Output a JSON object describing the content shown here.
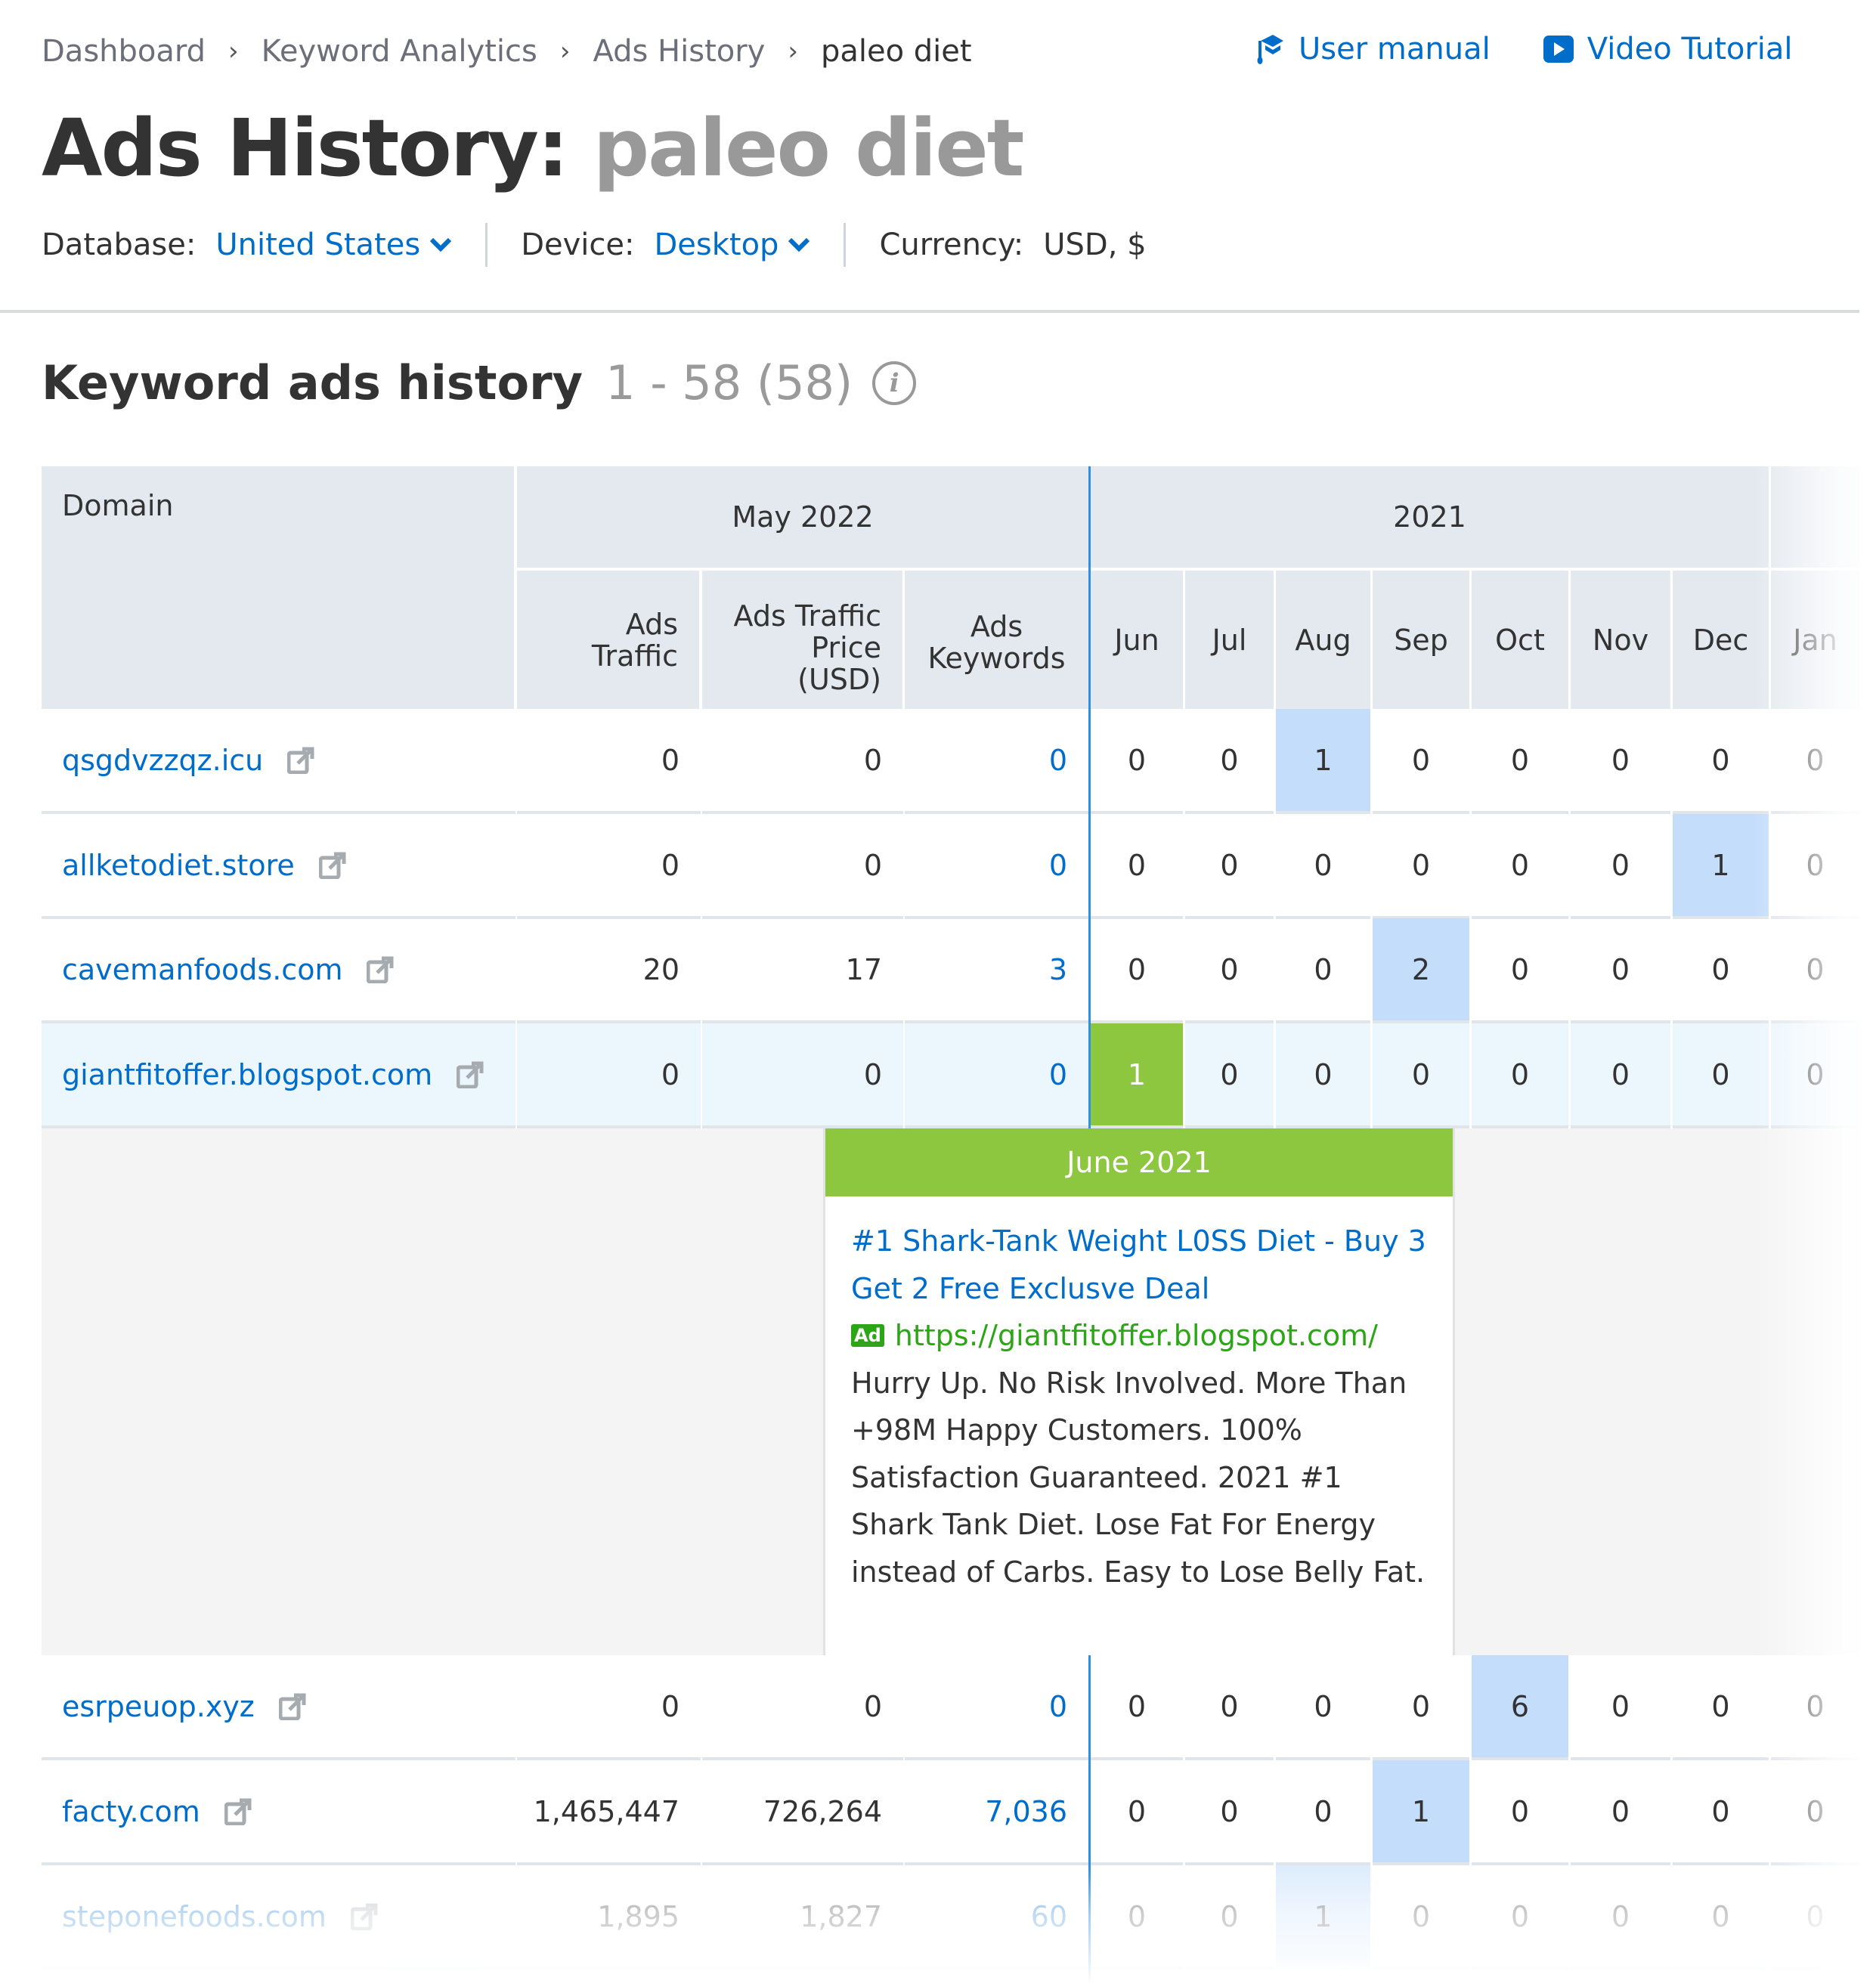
{
  "breadcrumb": [
    "Dashboard",
    "Keyword Analytics",
    "Ads History",
    "paleo diet"
  ],
  "top_links": {
    "user_manual": "User manual",
    "video_tutorial": "Video Tutorial"
  },
  "title": {
    "prefix": "Ads History:",
    "keyword": "paleo diet"
  },
  "filters": {
    "database_label": "Database:",
    "database_value": "United States",
    "device_label": "Device:",
    "device_value": "Desktop",
    "currency_label": "Currency:",
    "currency_value": "USD, $"
  },
  "section": {
    "title": "Keyword ads history",
    "count": "1 - 58 (58)"
  },
  "table": {
    "domain_header": "Domain",
    "group_may": "May 2022",
    "group_year": "2021",
    "col_ads_traffic": "Ads Traffic",
    "col_ads_traffic_price": "Ads Traffic Price (USD)",
    "col_ads_keywords": "Ads Keywords",
    "months": [
      "Jun",
      "Jul",
      "Aug",
      "Sep",
      "Oct",
      "Nov",
      "Dec",
      "Jan"
    ],
    "rows_top": [
      {
        "domain": "qsgdvzzqz.icu",
        "traffic": "0",
        "price": "0",
        "keywords": "0",
        "months": [
          "0",
          "0",
          "1",
          "0",
          "0",
          "0",
          "0",
          "0"
        ]
      },
      {
        "domain": "allketodiet.store",
        "traffic": "0",
        "price": "0",
        "keywords": "0",
        "months": [
          "0",
          "0",
          "0",
          "0",
          "0",
          "0",
          "1",
          "0"
        ]
      },
      {
        "domain": "cavemanfoods.com",
        "traffic": "20",
        "price": "17",
        "keywords": "3",
        "months": [
          "0",
          "0",
          "0",
          "2",
          "0",
          "0",
          "0",
          "0"
        ]
      },
      {
        "domain": "giantfitoffer.blogspot.com",
        "traffic": "0",
        "price": "0",
        "keywords": "0",
        "months": [
          "1",
          "0",
          "0",
          "0",
          "0",
          "0",
          "0",
          "0"
        ]
      }
    ],
    "rows_bottom": [
      {
        "domain": "esrpeuop.xyz",
        "traffic": "0",
        "price": "0",
        "keywords": "0",
        "months": [
          "0",
          "0",
          "0",
          "0",
          "6",
          "0",
          "0",
          "0"
        ]
      },
      {
        "domain": "facty.com",
        "traffic": "1,465,447",
        "price": "726,264",
        "keywords": "7,036",
        "months": [
          "0",
          "0",
          "0",
          "1",
          "0",
          "0",
          "0",
          "0"
        ]
      },
      {
        "domain": "steponefoods.com",
        "traffic": "1,895",
        "price": "1,827",
        "keywords": "60",
        "months": [
          "0",
          "0",
          "1",
          "0",
          "0",
          "0",
          "0",
          "0"
        ]
      }
    ]
  },
  "popup": {
    "header": "June 2021",
    "ad_title": "#1 Shark-Tank Weight L0SS Diet - Buy 3 Get 2 Free Exclusve Deal",
    "ad_badge": "Ad",
    "ad_url": "https://giantfitoffer.blogspot.com/",
    "ad_text": "Hurry Up. No Risk Involved. More Than +98M Happy Customers. 100% Satisfaction Guaranteed. 2021 #1 Shark Tank Diet. Lose Fat For Energy instead of Carbs. Easy to Lose Belly Fat."
  },
  "colors": {
    "link": "#006dca",
    "highlight": "#c3ddfb",
    "selected_month": "#8dc63f",
    "ad_url": "#2ca516",
    "header_bg": "#e3e9ef"
  }
}
